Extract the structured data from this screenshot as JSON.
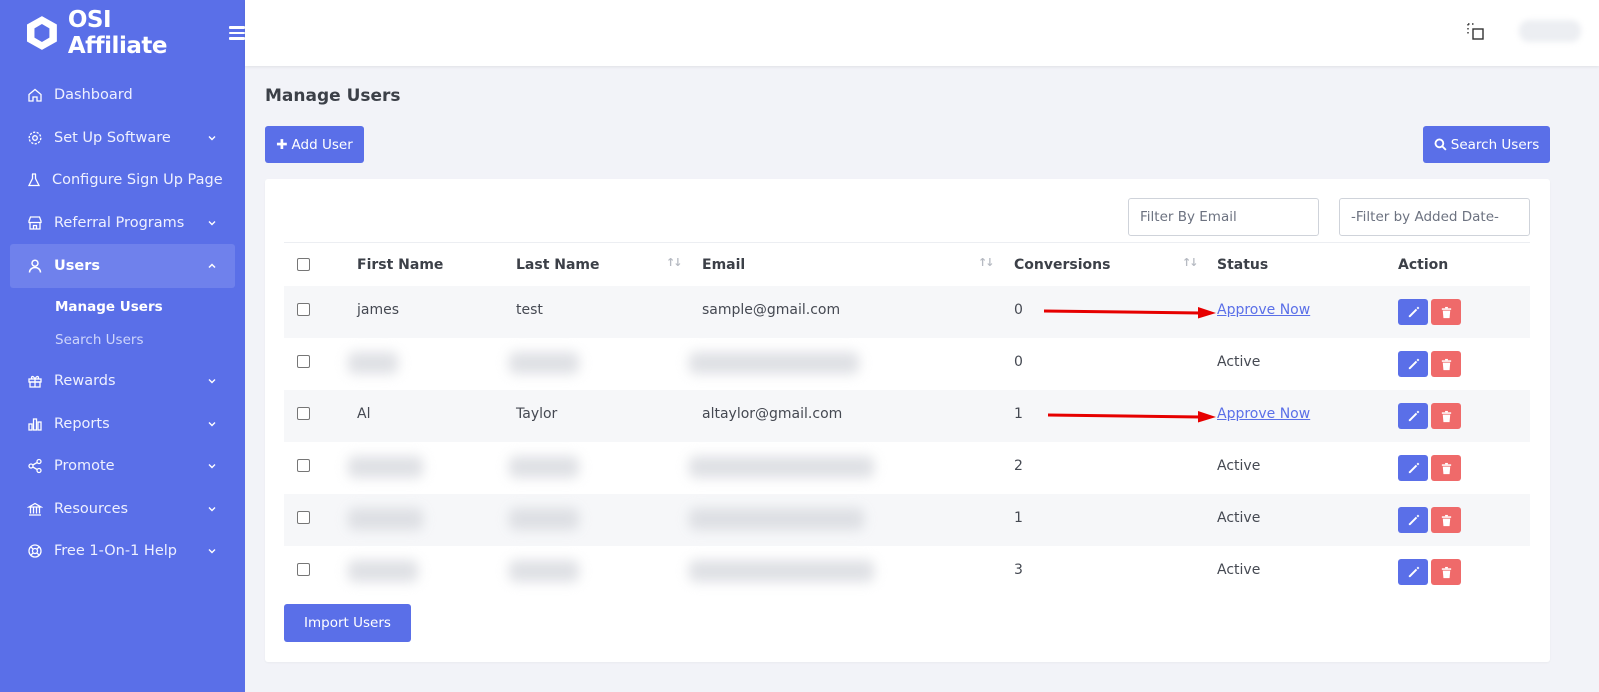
{
  "brand": {
    "name": "OSI Affiliate"
  },
  "sidebar": {
    "items": [
      {
        "label": "Dashboard",
        "icon": "home-icon"
      },
      {
        "label": "Set Up Software",
        "icon": "gear-icon"
      },
      {
        "label": "Configure Sign Up Page",
        "icon": "flask-icon"
      },
      {
        "label": "Referral Programs",
        "icon": "store-icon"
      },
      {
        "label": "Users",
        "icon": "user-icon"
      },
      {
        "label": "Rewards",
        "icon": "gift-icon"
      },
      {
        "label": "Reports",
        "icon": "bar-chart-icon"
      },
      {
        "label": "Promote",
        "icon": "share-icon"
      },
      {
        "label": "Resources",
        "icon": "bank-icon"
      },
      {
        "label": "Free 1-On-1 Help",
        "icon": "lifebuoy-icon"
      }
    ],
    "users_sub": [
      {
        "label": "Manage Users"
      },
      {
        "label": "Search Users"
      }
    ]
  },
  "page": {
    "title": "Manage Users",
    "add_user": "Add User",
    "search_users": "Search Users",
    "import_users": "Import Users"
  },
  "filters": {
    "email_placeholder": "Filter By Email",
    "date_placeholder": "-Filter by Added Date-"
  },
  "table": {
    "headers": {
      "first_name": "First Name",
      "last_name": "Last Name",
      "email": "Email",
      "conversions": "Conversions",
      "status": "Status",
      "action": "Action"
    },
    "rows": [
      {
        "first": "james",
        "last": "test",
        "email": "sample@gmail.com",
        "conversions": "0",
        "status": "Approve Now"
      },
      {
        "first": "",
        "last": "",
        "email": "",
        "conversions": "0",
        "status": "Active"
      },
      {
        "first": "Al",
        "last": "Taylor",
        "email": "altaylor@gmail.com",
        "conversions": "1",
        "status": "Approve Now"
      },
      {
        "first": "",
        "last": "",
        "email": "",
        "conversions": "2",
        "status": "Active"
      },
      {
        "first": "",
        "last": "",
        "email": "",
        "conversions": "1",
        "status": "Active"
      },
      {
        "first": "",
        "last": "",
        "email": "",
        "conversions": "3",
        "status": "Active"
      }
    ]
  },
  "colors": {
    "sidebar": "#5a6fe8",
    "primary": "#5a6fe8",
    "danger": "#ef6a6a",
    "arrow": "#e60000"
  }
}
